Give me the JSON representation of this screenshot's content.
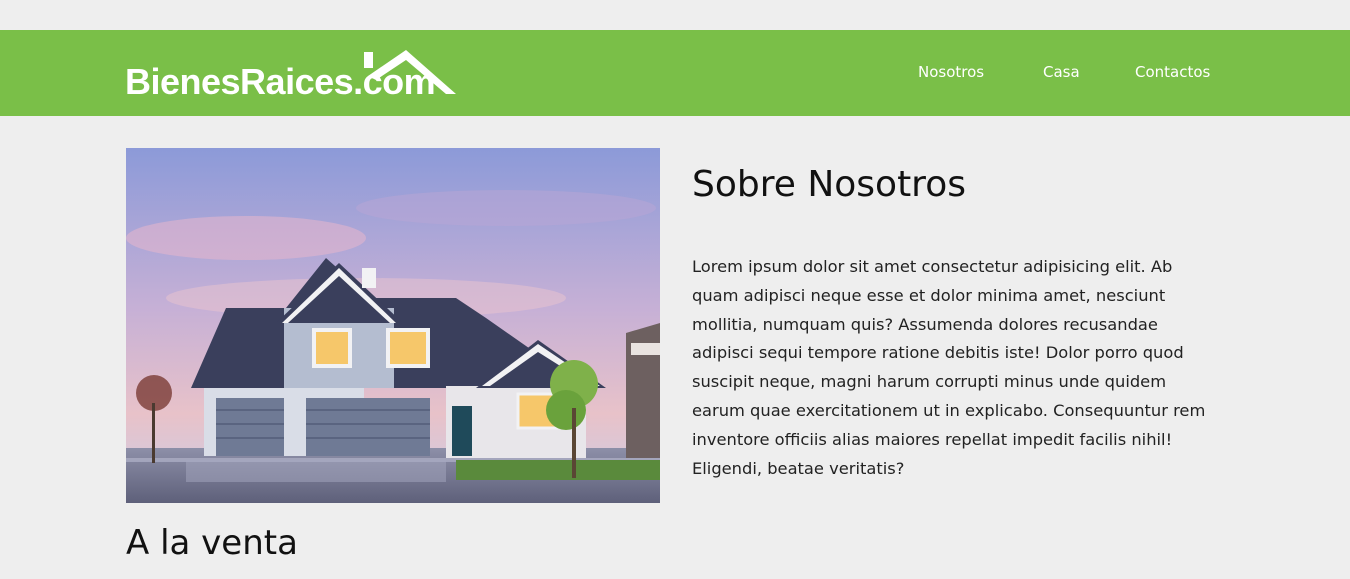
{
  "header": {
    "logo_text": "BienesRaices.com",
    "brand_color": "#7abf48",
    "nav": [
      {
        "label": "Nosotros"
      },
      {
        "label": "Casa"
      },
      {
        "label": "Contactos"
      }
    ]
  },
  "about": {
    "image_icon": "house-photo",
    "title": "Sobre Nosotros",
    "text": "Lorem ipsum dolor sit amet consectetur adipisicing elit. Ab quam adipisci neque esse et dolor minima amet, nesciunt mollitia, numquam quis? Assumenda dolores recusandae adipisci sequi tempore ratione debitis iste! Dolor porro quod suscipit neque, magni harum corrupti minus unde quidem earum quae exercitationem ut in explicabo. Consequuntur rem inventore officiis alias maiores repellat impedit facilis nihil! Eligendi, beatae veritatis?"
  },
  "sale": {
    "title": "A la venta"
  }
}
